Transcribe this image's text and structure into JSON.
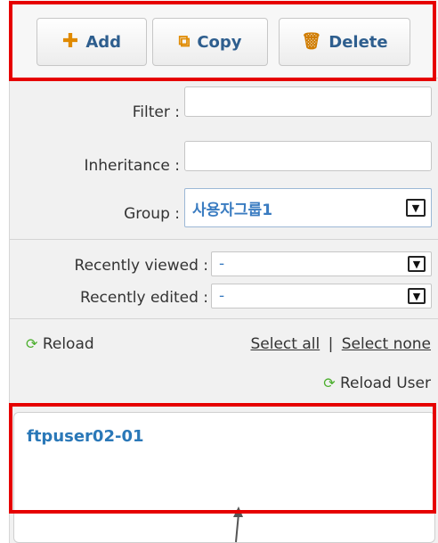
{
  "toolbar": {
    "add_label": "Add",
    "copy_label": "Copy",
    "delete_label": "Delete"
  },
  "form": {
    "filter_label": "Filter :",
    "filter_value": "",
    "inheritance_label": "Inheritance :",
    "inheritance_value": "",
    "group_label": "Group :",
    "group_value": "사용자그룹1",
    "recently_viewed_label": "Recently viewed :",
    "recently_viewed_value": "-",
    "recently_edited_label": "Recently edited :",
    "recently_edited_value": "-"
  },
  "actions": {
    "reload_label": "Reload",
    "select_all_label": "Select all",
    "separator": "|",
    "select_none_label": "Select none",
    "reload_user_label": "Reload User"
  },
  "user_list": {
    "items": [
      "ftpuser02-01"
    ]
  },
  "colors": {
    "highlight": "#e60000",
    "link": "#2a78b8",
    "accent_icon": "#e08a00",
    "reload_icon": "#4caf2e"
  },
  "icons": {
    "add": "plus-icon",
    "copy": "copy-icon",
    "delete": "trash-icon",
    "reload": "reload-icon",
    "dropdown": "chevron-down-icon"
  }
}
